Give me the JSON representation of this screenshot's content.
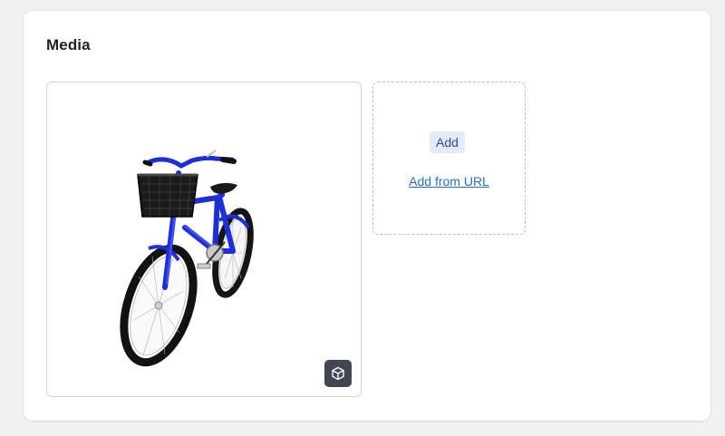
{
  "card": {
    "title": "Media"
  },
  "media_item": {
    "badge_icon": "3d-model-icon",
    "image_subject": "blue-bicycle"
  },
  "dropzone": {
    "add_label": "Add",
    "add_from_url_label": "Add from URL"
  },
  "colors": {
    "background": "#f1f1f1",
    "card": "#ffffff",
    "link": "#2c6ecb",
    "add_button_bg": "#e4ebf8",
    "badge_bg": "#414750",
    "bike_frame": "#1e2fd6"
  }
}
